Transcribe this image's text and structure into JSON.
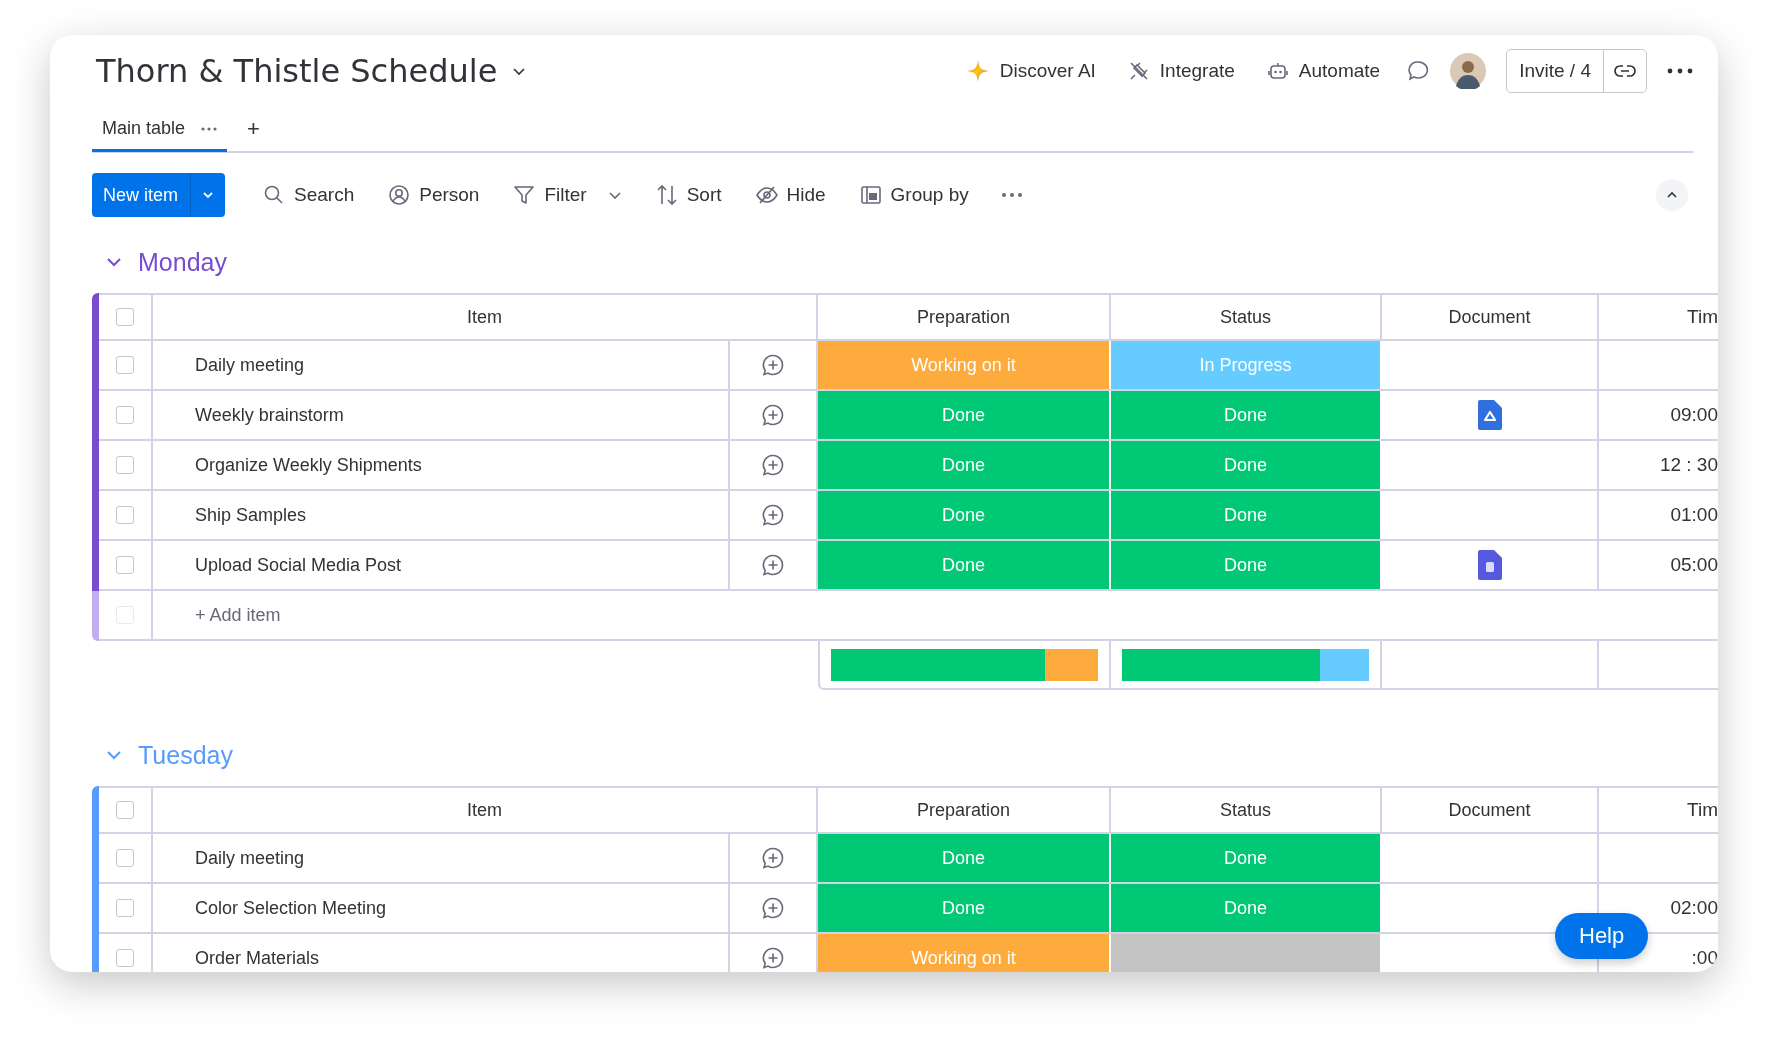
{
  "board": {
    "title": "Thorn & Thistle Schedule"
  },
  "header_actions": [
    {
      "kind": "ai",
      "label": "Discover AI"
    },
    {
      "kind": "integrate",
      "label": "Integrate"
    },
    {
      "kind": "automate",
      "label": "Automate"
    }
  ],
  "invite": {
    "label": "Invite / 4"
  },
  "tabs": [
    {
      "label": "Main table",
      "selected": true
    }
  ],
  "add_tab": "+",
  "toolbar": {
    "new_item": "New item",
    "tools": [
      {
        "kind": "search",
        "label": "Search"
      },
      {
        "kind": "person",
        "label": "Person"
      },
      {
        "kind": "filter",
        "label": "Filter"
      },
      {
        "kind": "sort",
        "label": "Sort"
      },
      {
        "kind": "hide",
        "label": "Hide"
      },
      {
        "kind": "group",
        "label": "Group by"
      }
    ]
  },
  "groups": [
    {
      "title": "Monday",
      "color": "#784bd1",
      "all_checked": false,
      "add_item_checked": false,
      "progress": [
        {
          "level": 0.8
        },
        {
          "level": 0.8
        }
      ],
      "columns": [
        "Item",
        "Preparation",
        "Status",
        "Document",
        "Tim"
      ],
      "add_item": "+ Add item",
      "rows": [
        {
          "name": "Daily meeting",
          "checked": false,
          "preparation": {
            "label": "Working on it",
            "color": "#fdab3d"
          },
          "status": {
            "label": "In Progress",
            "color": "#66ccff"
          }
        },
        {
          "name": "Weekly brainstorm",
          "checked": false,
          "preparation": {
            "label": "Done",
            "color": "#00c875"
          },
          "status": {
            "label": "Done",
            "color": "#00c875"
          },
          "document": {
            "kind": "drive"
          },
          "time": "09:00"
        },
        {
          "name": "Organize Weekly Shipments",
          "checked": false,
          "preparation": {
            "label": "Done",
            "color": "#00c875"
          },
          "status": {
            "label": "Done",
            "color": "#00c875"
          },
          "time": "12 : 30"
        },
        {
          "name": "Ship Samples",
          "checked": false,
          "preparation": {
            "label": "Done",
            "color": "#00c875"
          },
          "status": {
            "label": "Done",
            "color": "#00c875"
          },
          "time": "01:00"
        },
        {
          "name": "Upload Social Media Post",
          "checked": false,
          "preparation": {
            "label": "Done",
            "color": "#00c875"
          },
          "status": {
            "label": "Done",
            "color": "#00c875"
          },
          "document": {
            "kind": "file"
          },
          "time": "05:00"
        }
      ]
    },
    {
      "title": "Tuesday",
      "color": "#579bfc",
      "all_checked": false,
      "columns": [
        "Item",
        "Preparation",
        "Status",
        "Document",
        "Tim"
      ],
      "rows": [
        {
          "name": "Daily meeting",
          "checked": false,
          "preparation": {
            "label": "Done",
            "color": "#00c875"
          },
          "status": {
            "label": "Done",
            "color": "#00c875"
          }
        },
        {
          "name": "Color Selection Meeting",
          "checked": false,
          "preparation": {
            "label": "Done",
            "color": "#00c875"
          },
          "status": {
            "label": "Done",
            "color": "#00c875"
          },
          "time": "02:00"
        },
        {
          "name": "Order Materials",
          "checked": false,
          "preparation": {
            "label": "Working on it",
            "color": "#fdab3d"
          },
          "status": {
            "color": "#c4c4c4"
          },
          "time": ":00"
        }
      ]
    }
  ],
  "help": "Help"
}
